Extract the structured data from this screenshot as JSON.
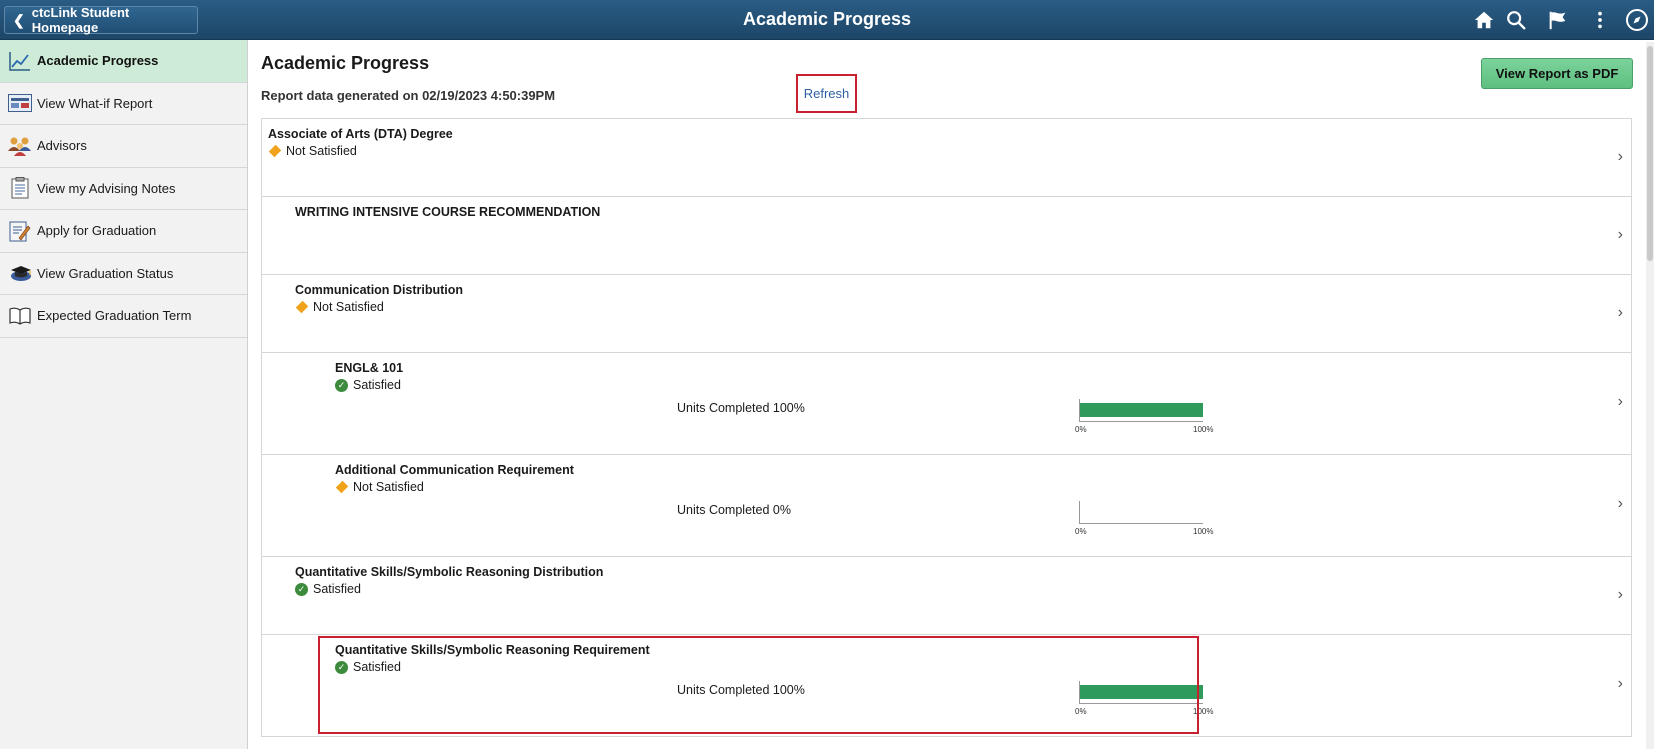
{
  "header": {
    "back_label": "ctcLink Student Homepage",
    "title": "Academic Progress",
    "icons": [
      "home-icon",
      "search-icon",
      "flag-icon",
      "more-icon",
      "navbar-compass-icon"
    ]
  },
  "sidebar": {
    "items": [
      {
        "label": "Academic Progress",
        "icon": "chart-line-icon",
        "active": true
      },
      {
        "label": "View What-if Report",
        "icon": "report-icon",
        "active": false
      },
      {
        "label": "Advisors",
        "icon": "people-icon",
        "active": false
      },
      {
        "label": "View my Advising Notes",
        "icon": "clipboard-icon",
        "active": false
      },
      {
        "label": "Apply for Graduation",
        "icon": "form-pencil-icon",
        "active": false
      },
      {
        "label": "View Graduation Status",
        "icon": "graduation-cap-icon",
        "active": false
      },
      {
        "label": "Expected Graduation Term",
        "icon": "book-icon",
        "active": false
      }
    ]
  },
  "main": {
    "title": "Academic Progress",
    "report_generated": "Report data generated on 02/19/2023 4:50:39PM",
    "refresh_label": "Refresh",
    "pdf_button": "View Report as PDF",
    "rows": [
      {
        "title": "Associate of Arts (DTA) Degree",
        "status": "Not Satisfied",
        "status_type": "not-satisfied"
      },
      {
        "title": "WRITING INTENSIVE COURSE RECOMMENDATION",
        "status": "",
        "status_type": "none"
      },
      {
        "title": "Communication Distribution",
        "status": "Not Satisfied",
        "status_type": "not-satisfied"
      },
      {
        "title": "ENGL& 101",
        "status": "Satisfied",
        "status_type": "satisfied",
        "units": "Units Completed 100%",
        "progress": 100
      },
      {
        "title": "Additional Communication Requirement",
        "status": "Not Satisfied",
        "status_type": "not-satisfied",
        "units": "Units Completed 0%",
        "progress": 0
      },
      {
        "title": "Quantitative Skills/Symbolic Reasoning Distribution",
        "status": "Satisfied",
        "status_type": "satisfied"
      },
      {
        "title": "Quantitative Skills/Symbolic Reasoning Requirement",
        "status": "Satisfied",
        "status_type": "satisfied",
        "units": "Units Completed 100%",
        "progress": 100
      }
    ],
    "tick_min": "0%",
    "tick_max": "100%"
  },
  "colors": {
    "header_bg": "#1d4668",
    "active_item_bg": "#cdebd7",
    "pdf_button_bg": "#6cc98d",
    "progress_fill": "#2e9b5d",
    "not_satisfied": "#f0a21b",
    "satisfied": "#3d8b3d",
    "highlight": "#c8202f"
  }
}
